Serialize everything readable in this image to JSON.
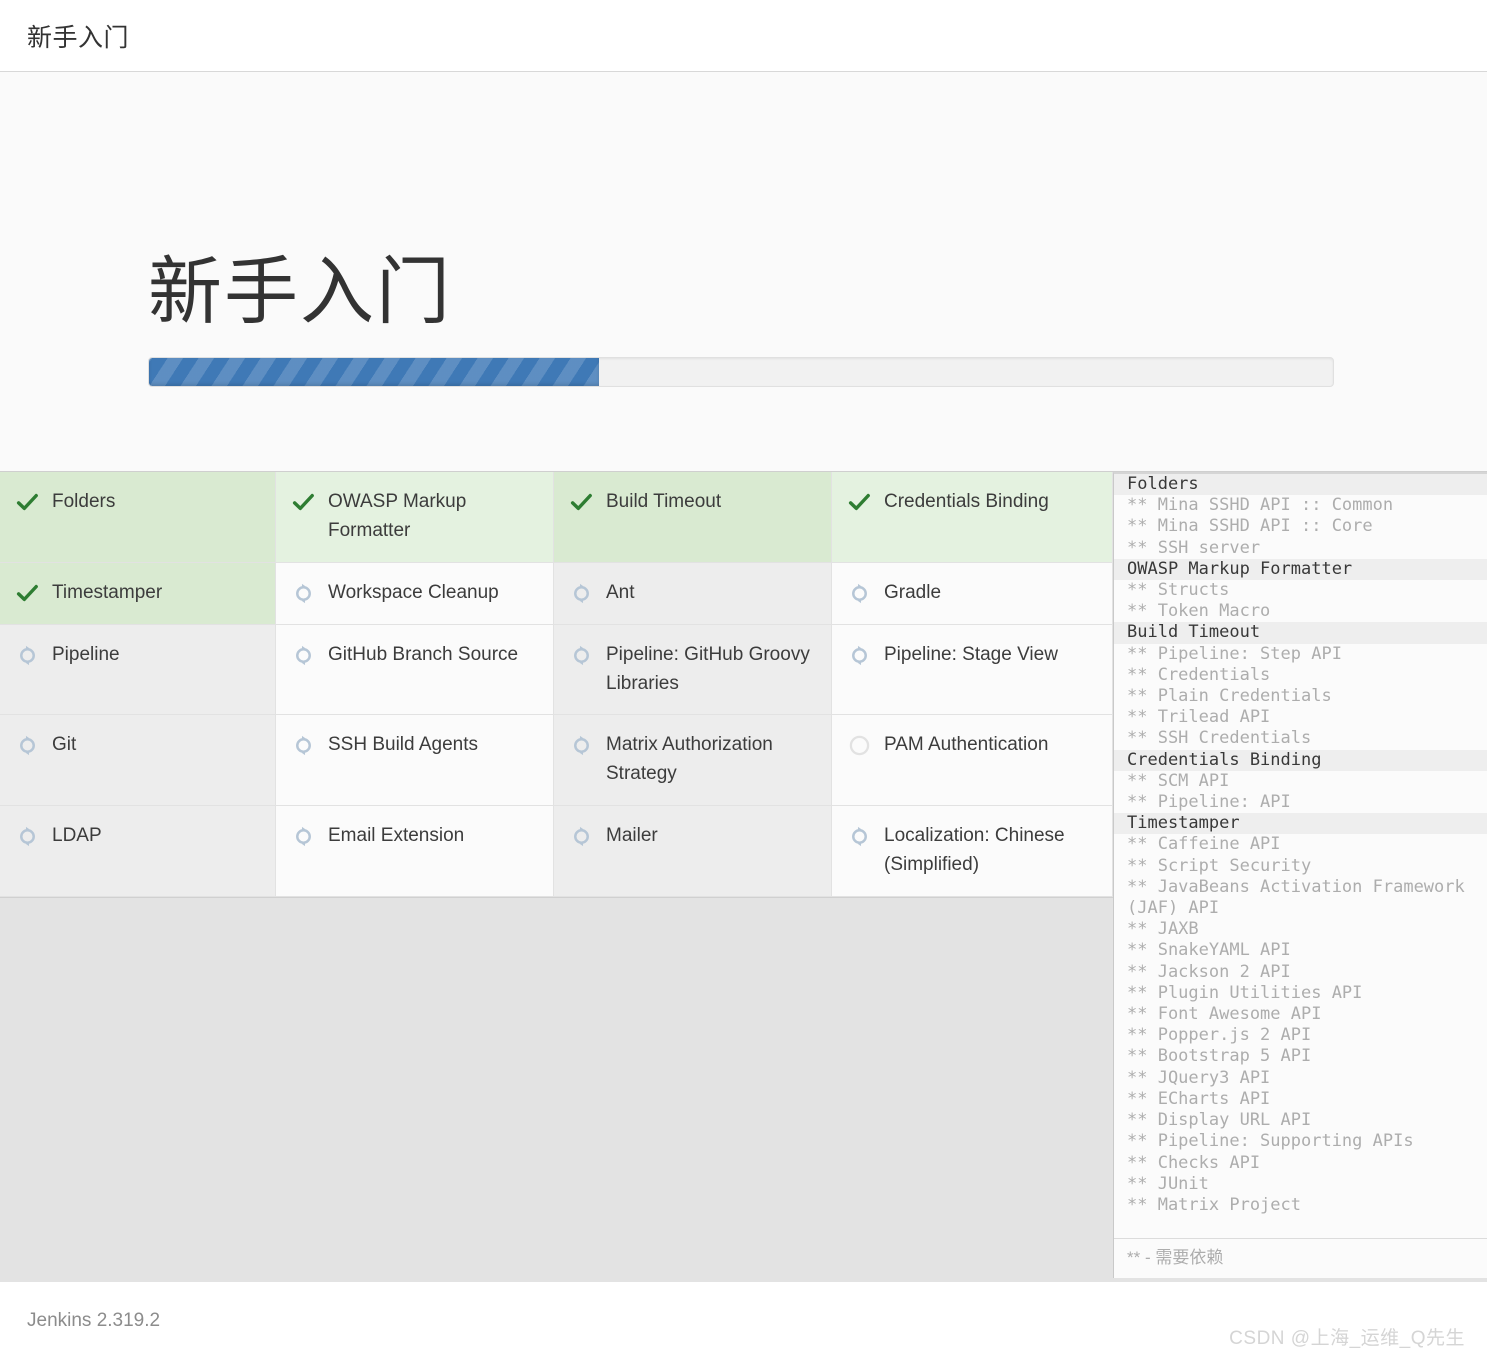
{
  "topbar": {
    "title": "新手入门"
  },
  "hero": {
    "title": "新手入门",
    "progress_percent": 38
  },
  "colors": {
    "progress_fill": "#3f79b6",
    "progress_track": "#f1f1f1",
    "done_check": "#2e7d32",
    "spinner": "#b6c6d6",
    "done_bg_odd": "#d9ead1",
    "done_bg_even": "#e4f2e0"
  },
  "plugins": [
    {
      "label": "Folders",
      "status": "done",
      "icon": "check-icon"
    },
    {
      "label": "OWASP Markup Formatter",
      "status": "done",
      "icon": "check-icon"
    },
    {
      "label": "Build Timeout",
      "status": "done",
      "icon": "check-icon"
    },
    {
      "label": "Credentials Binding",
      "status": "done",
      "icon": "check-icon"
    },
    {
      "label": "Timestamper",
      "status": "done",
      "icon": "check-icon"
    },
    {
      "label": "Workspace Cleanup",
      "status": "loading",
      "icon": "spinner-icon"
    },
    {
      "label": "Ant",
      "status": "loading",
      "icon": "spinner-icon"
    },
    {
      "label": "Gradle",
      "status": "loading",
      "icon": "spinner-icon"
    },
    {
      "label": "Pipeline",
      "status": "loading",
      "icon": "spinner-icon"
    },
    {
      "label": "GitHub Branch Source",
      "status": "loading",
      "icon": "spinner-icon"
    },
    {
      "label": "Pipeline: GitHub Groovy Libraries",
      "status": "loading",
      "icon": "spinner-icon"
    },
    {
      "label": "Pipeline: Stage View",
      "status": "loading",
      "icon": "spinner-icon"
    },
    {
      "label": "Git",
      "status": "loading",
      "icon": "spinner-icon"
    },
    {
      "label": "SSH Build Agents",
      "status": "loading",
      "icon": "spinner-icon"
    },
    {
      "label": "Matrix Authorization Strategy",
      "status": "loading",
      "icon": "spinner-icon"
    },
    {
      "label": "PAM Authentication",
      "status": "pending",
      "icon": "circle-icon"
    },
    {
      "label": "LDAP",
      "status": "loading",
      "icon": "spinner-icon"
    },
    {
      "label": "Email Extension",
      "status": "loading",
      "icon": "spinner-icon"
    },
    {
      "label": "Mailer",
      "status": "loading",
      "icon": "spinner-icon"
    },
    {
      "label": "Localization: Chinese (Simplified)",
      "status": "loading",
      "icon": "spinner-icon"
    }
  ],
  "log": {
    "lines": [
      {
        "text": "Folders",
        "type": "plugin"
      },
      {
        "text": "** Mina SSHD API :: Common",
        "type": "dep"
      },
      {
        "text": "** Mina SSHD API :: Core",
        "type": "dep"
      },
      {
        "text": "** SSH server",
        "type": "dep"
      },
      {
        "text": "OWASP Markup Formatter",
        "type": "plugin"
      },
      {
        "text": "** Structs",
        "type": "dep"
      },
      {
        "text": "** Token Macro",
        "type": "dep"
      },
      {
        "text": "Build Timeout",
        "type": "plugin"
      },
      {
        "text": "** Pipeline: Step API",
        "type": "dep"
      },
      {
        "text": "** Credentials",
        "type": "dep"
      },
      {
        "text": "** Plain Credentials",
        "type": "dep"
      },
      {
        "text": "** Trilead API",
        "type": "dep"
      },
      {
        "text": "** SSH Credentials",
        "type": "dep"
      },
      {
        "text": "Credentials Binding",
        "type": "plugin"
      },
      {
        "text": "** SCM API",
        "type": "dep"
      },
      {
        "text": "** Pipeline: API",
        "type": "dep"
      },
      {
        "text": "Timestamper",
        "type": "plugin"
      },
      {
        "text": "** Caffeine API",
        "type": "dep"
      },
      {
        "text": "** Script Security",
        "type": "dep"
      },
      {
        "text": "** JavaBeans Activation Framework (JAF) API",
        "type": "dep"
      },
      {
        "text": "** JAXB",
        "type": "dep"
      },
      {
        "text": "** SnakeYAML API",
        "type": "dep"
      },
      {
        "text": "** Jackson 2 API",
        "type": "dep"
      },
      {
        "text": "** Plugin Utilities API",
        "type": "dep"
      },
      {
        "text": "** Font Awesome API",
        "type": "dep"
      },
      {
        "text": "** Popper.js 2 API",
        "type": "dep"
      },
      {
        "text": "** Bootstrap 5 API",
        "type": "dep"
      },
      {
        "text": "** JQuery3 API",
        "type": "dep"
      },
      {
        "text": "** ECharts API",
        "type": "dep"
      },
      {
        "text": "** Display URL API",
        "type": "dep"
      },
      {
        "text": "** Pipeline: Supporting APIs",
        "type": "dep"
      },
      {
        "text": "** Checks API",
        "type": "dep"
      },
      {
        "text": "** JUnit",
        "type": "dep"
      },
      {
        "text": "** Matrix Project",
        "type": "dep"
      }
    ],
    "footer_note": "** - 需要依赖"
  },
  "footer": {
    "version": "Jenkins 2.319.2",
    "watermark": "CSDN @上海_运维_Q先生"
  }
}
